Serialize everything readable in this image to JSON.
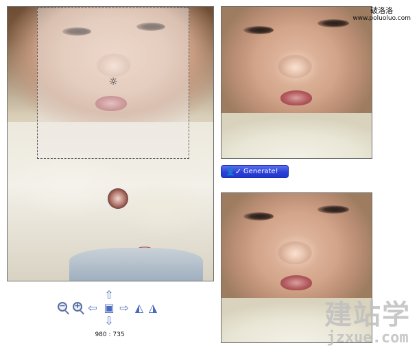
{
  "watermark_top": {
    "chinese": "破洛洛",
    "url": "www.poluoluo.com"
  },
  "watermark_bottom": {
    "logo": "建站学",
    "site": "jzxue.com"
  },
  "crop": {
    "handle_glyph": "☼"
  },
  "generate_button": {
    "label": "Generate!",
    "icon": "user-check-icon",
    "icon_glyph": "👤✓"
  },
  "toolbar": {
    "zoom_out": {
      "icon": "zoom-out-icon",
      "glyph": "−"
    },
    "zoom_in": {
      "icon": "zoom-in-icon",
      "glyph": "+"
    },
    "move_left": {
      "icon": "arrow-left-icon",
      "glyph": "⇦"
    },
    "move_up": {
      "icon": "arrow-up-icon",
      "glyph": "⇧"
    },
    "center": {
      "icon": "center-icon",
      "glyph": "▣"
    },
    "move_down": {
      "icon": "arrow-down-icon",
      "glyph": "⇩"
    },
    "move_right": {
      "icon": "arrow-right-icon",
      "glyph": "⇨"
    },
    "rotate_left": {
      "icon": "rotate-left-icon",
      "glyph": "◭"
    },
    "rotate_right": {
      "icon": "rotate-right-icon",
      "glyph": "◮"
    }
  },
  "dimensions": "980 : 735"
}
